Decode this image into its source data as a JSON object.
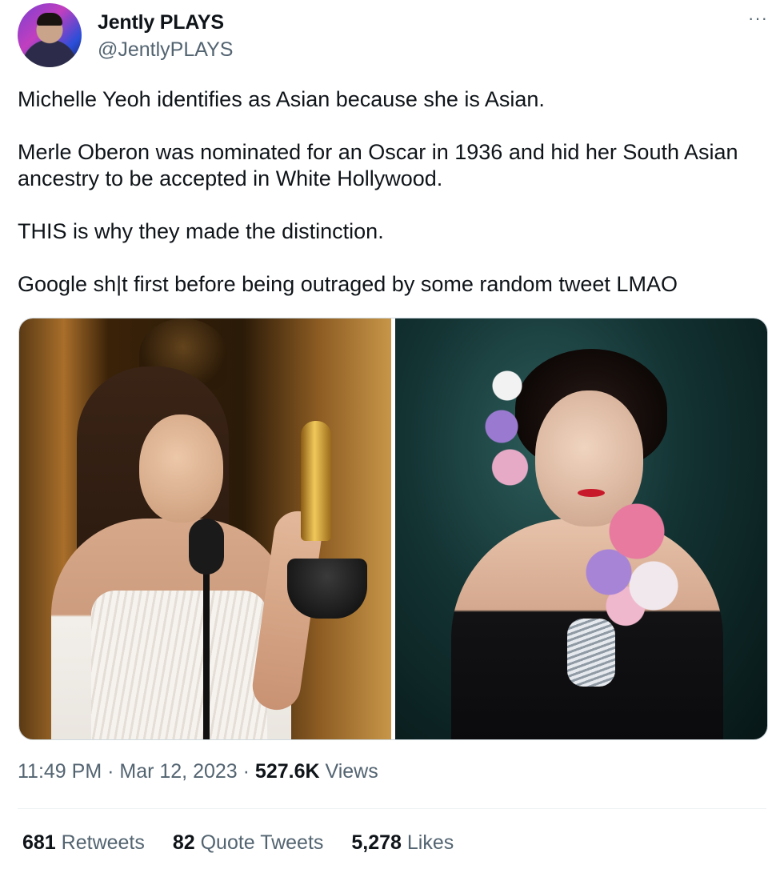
{
  "author": {
    "display_name": "Jently PLAYS",
    "handle": "@JentlyPLAYS",
    "more_label": "···"
  },
  "tweet": {
    "paragraphs": [
      "Michelle Yeoh identifies as Asian because she is Asian.",
      "Merle Oberon was nominated for an Oscar in 1936 and hid her South Asian ancestry to be accepted in White Hollywood.",
      "THIS is why they made the distinction.",
      "Google sh|t first before being outraged by some random tweet LMAO"
    ]
  },
  "media": {
    "images": [
      {
        "icon": "photo-michelle-yeoh-oscar"
      },
      {
        "icon": "photo-merle-oberon-flowers"
      }
    ]
  },
  "meta": {
    "time": "11:49 PM",
    "dot1": " · ",
    "date": "Mar 12, 2023",
    "dot2": " · ",
    "views_count": "527.6K",
    "views_label": " Views"
  },
  "stats": {
    "retweets": {
      "count": "681",
      "label": " Retweets"
    },
    "quotes": {
      "count": "82",
      "label": " Quote Tweets"
    },
    "likes": {
      "count": "5,278",
      "label": " Likes"
    }
  },
  "colors": {
    "text": "#0f1419",
    "secondary": "#536471",
    "border": "#cfd9de"
  }
}
